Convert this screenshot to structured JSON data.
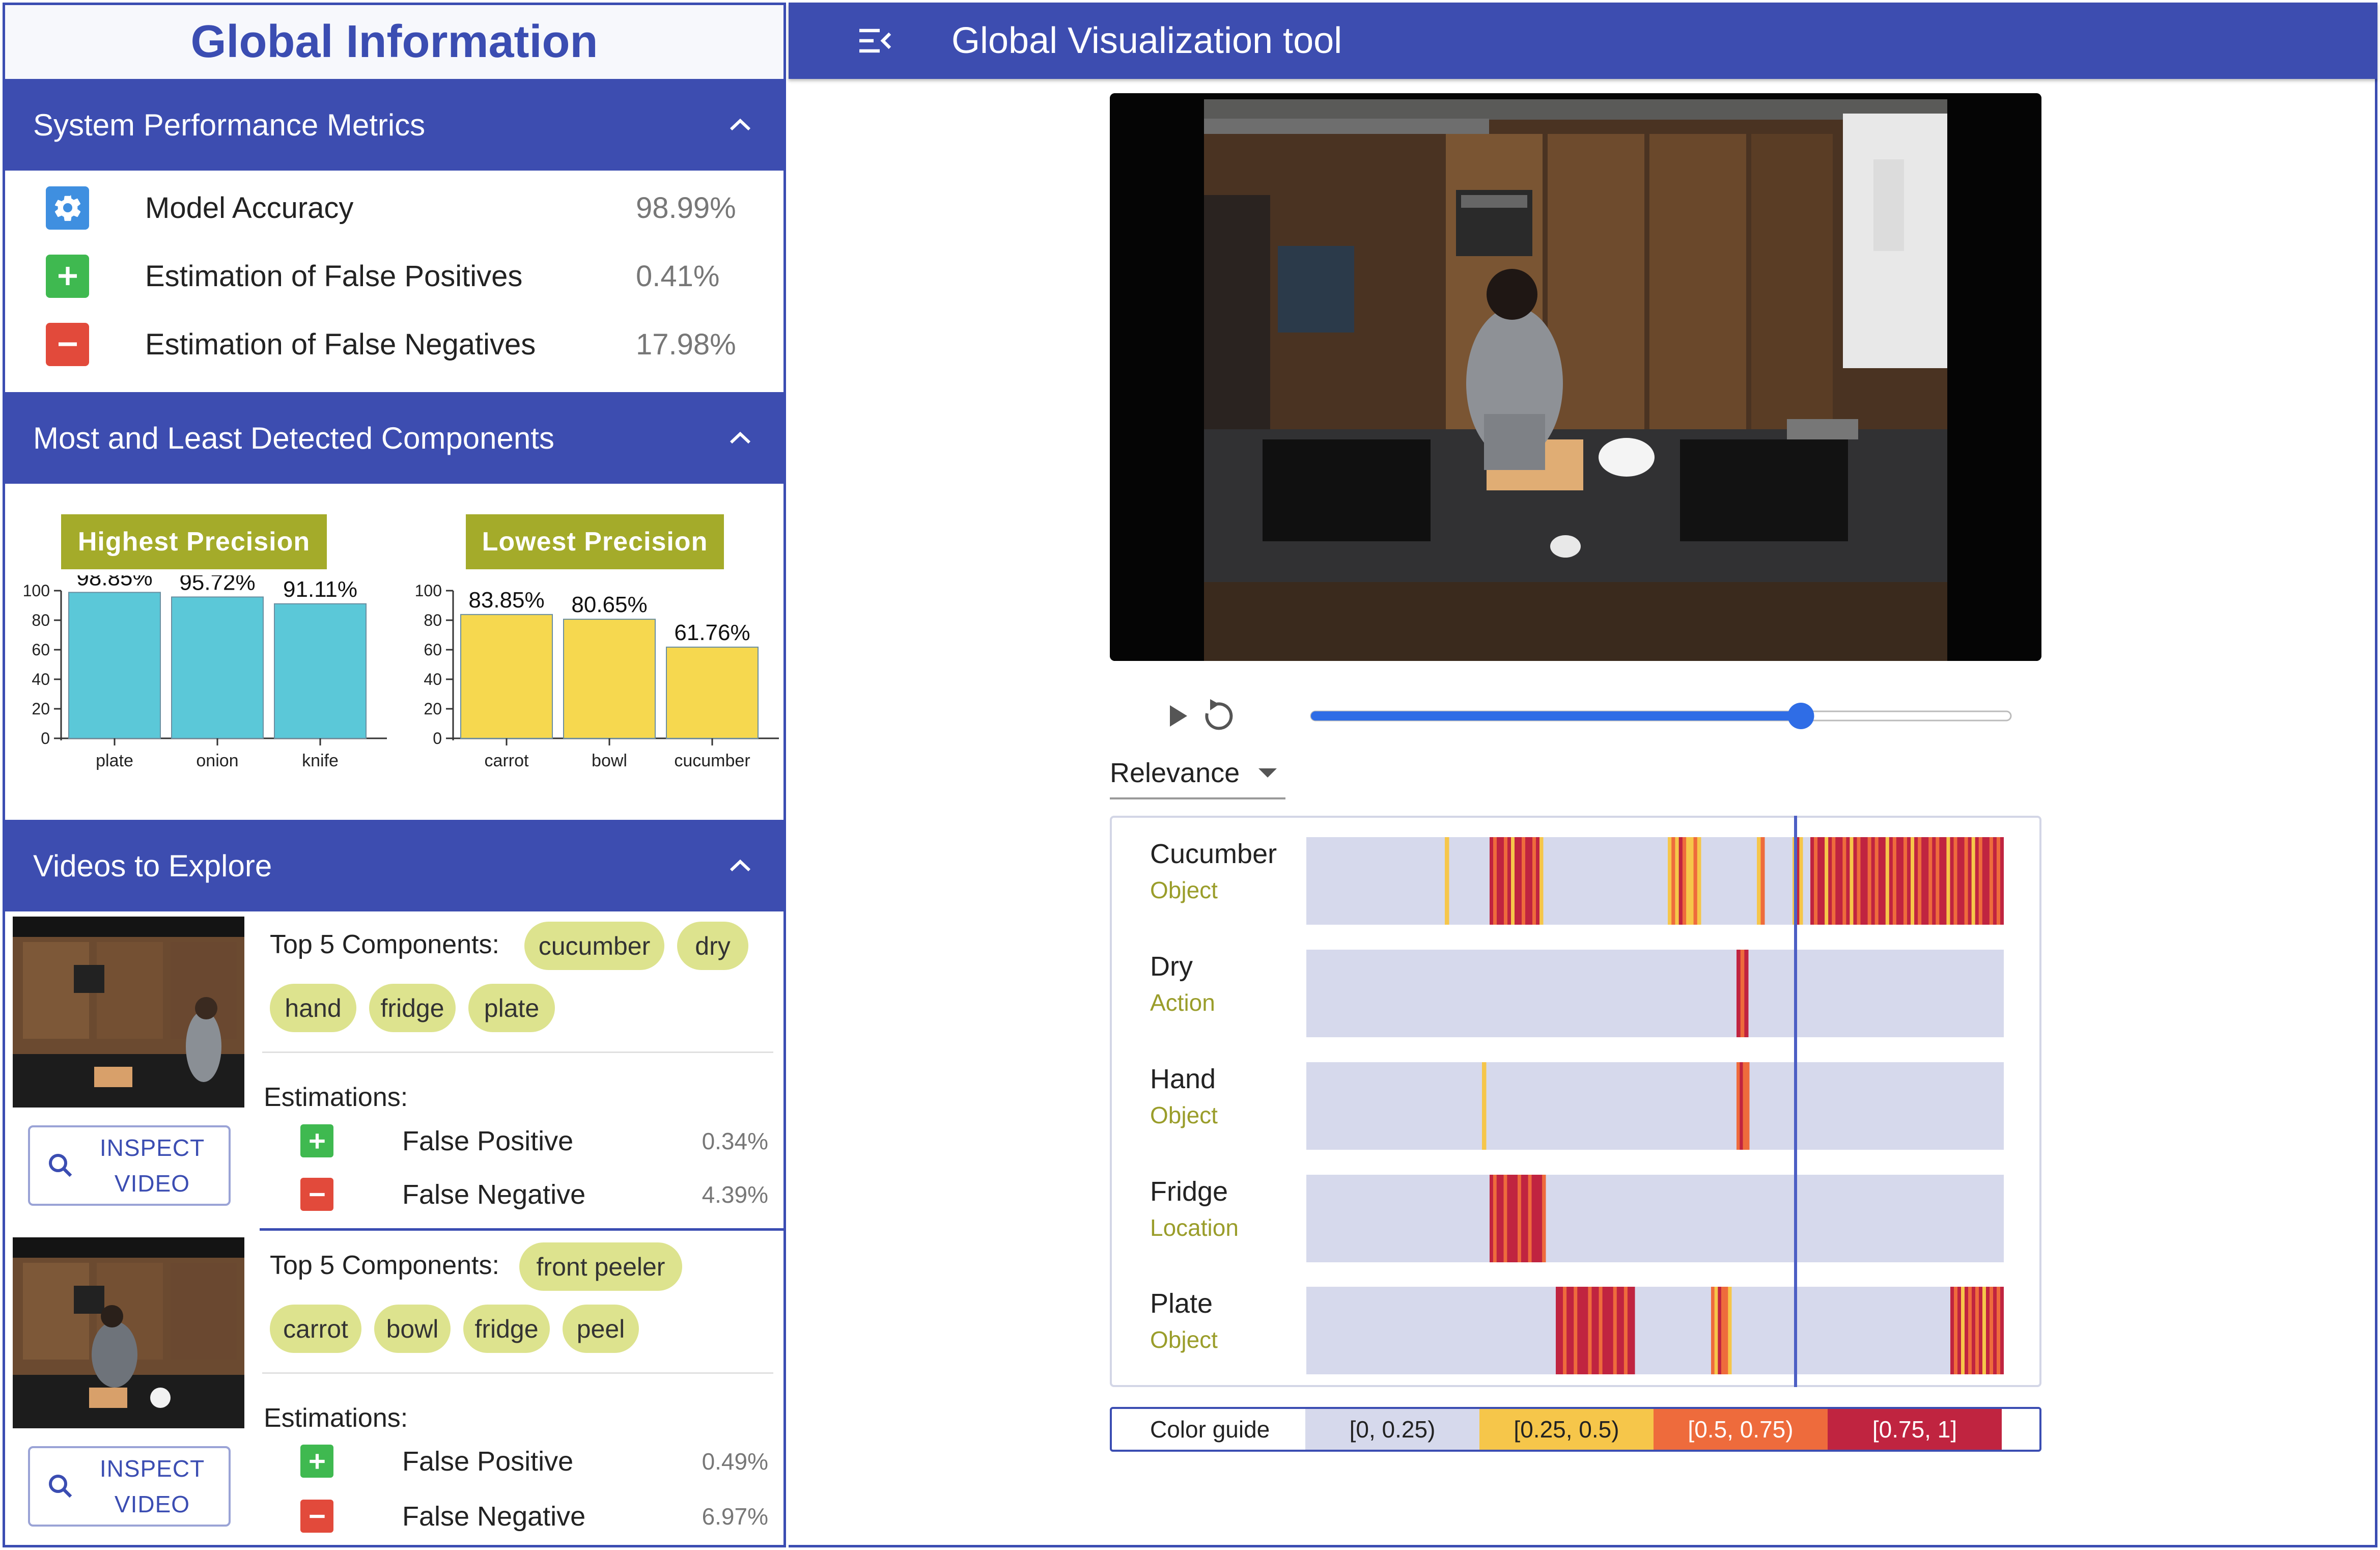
{
  "left_panel": {
    "title": "Global Information",
    "performance": {
      "header": "System Performance Metrics",
      "metrics": [
        {
          "label": "Model Accuracy",
          "value": "98.99%",
          "icon": "gear-icon",
          "color": "#3f8fe0"
        },
        {
          "label": "Estimation of False Positives",
          "value": "0.41%",
          "icon": "plus-icon",
          "color": "#3fb950"
        },
        {
          "label": "Estimation of False Negatives",
          "value": "17.98%",
          "icon": "minus-icon",
          "color": "#e24a3b"
        }
      ]
    },
    "components": {
      "header": "Most and Least Detected Components",
      "highest_label": "Highest Precision",
      "lowest_label": "Lowest Precision"
    },
    "videos": {
      "header": "Videos to Explore",
      "top5_label": "Top 5 Components:",
      "estimations_label": "Estimations:",
      "inspect_line1": "INSPECT",
      "inspect_line2": "VIDEO",
      "fp_label": "False Positive",
      "fn_label": "False Negative",
      "items": [
        {
          "chips": [
            "cucumber",
            "dry",
            "hand",
            "fridge",
            "plate"
          ],
          "false_positive": "0.34%",
          "false_negative": "4.39%"
        },
        {
          "chips": [
            "front peeler",
            "carrot",
            "bowl",
            "fridge",
            "peel"
          ],
          "false_positive": "0.49%",
          "false_negative": "6.97%"
        }
      ]
    }
  },
  "app": {
    "title": "Global Visualization tool",
    "menu_icon": "menu-collapse-icon",
    "player": {
      "play_icon": "play-icon",
      "replay_icon": "replay-icon",
      "progress": 0.7
    },
    "sort_select": "Relevance",
    "timeline_rows": [
      {
        "name": "Cucumber",
        "type": "Object"
      },
      {
        "name": "Dry",
        "type": "Action"
      },
      {
        "name": "Hand",
        "type": "Object"
      },
      {
        "name": "Fridge",
        "type": "Location"
      },
      {
        "name": "Plate",
        "type": "Object"
      }
    ],
    "cursor_position": 0.7,
    "color_guide": {
      "label": "Color guide",
      "bins": [
        {
          "range": "[0, 0.25)",
          "color": "#d6d9ec",
          "text": "#222222"
        },
        {
          "range": "[0.25, 0.5)",
          "color": "#f6c64a",
          "text": "#222222"
        },
        {
          "range": "[0.5, 0.75)",
          "color": "#ee6b3c",
          "text": "#ffffff"
        },
        {
          "range": "[0.75, 1]",
          "color": "#c02440",
          "text": "#ffffff"
        }
      ]
    }
  },
  "chart_data": [
    {
      "type": "bar",
      "title": "Highest Precision",
      "categories": [
        "plate",
        "onion",
        "knife"
      ],
      "values": [
        98.85,
        95.72,
        91.11
      ],
      "value_labels": [
        "98.85%",
        "95.72%",
        "91.11%"
      ],
      "ylim": [
        0,
        100
      ],
      "yticks": [
        0,
        20,
        40,
        60,
        80,
        100
      ],
      "color": "#5bc8d8"
    },
    {
      "type": "bar",
      "title": "Lowest Precision",
      "categories": [
        "carrot",
        "bowl",
        "cucumber"
      ],
      "values": [
        83.85,
        80.65,
        61.76
      ],
      "value_labels": [
        "83.85%",
        "80.65%",
        "61.76%"
      ],
      "ylim": [
        0,
        100
      ],
      "yticks": [
        0,
        20,
        40,
        60,
        80,
        100
      ],
      "color": "#f6d84f"
    }
  ]
}
